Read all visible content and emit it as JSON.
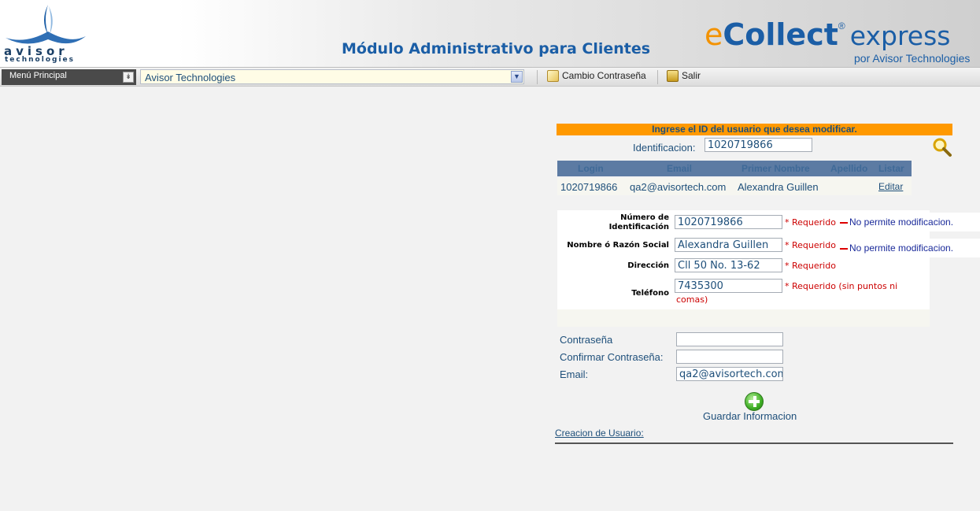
{
  "header": {
    "logo_word": "avisor",
    "logo_sub": "technologies",
    "title": "Módulo Administrativo para Clientes",
    "brand_e": "e",
    "brand_collect": "Collect",
    "brand_reg": "®",
    "brand_express": "express",
    "brand_by": "por Avisor Technologies"
  },
  "toolbar": {
    "menu_label": "Menú Principal",
    "company_selected": "Avisor Technologies",
    "change_password_label": "Cambio Contraseña",
    "exit_label": "Salir"
  },
  "search": {
    "banner": "Ingrese el ID del usuario que desea modificar.",
    "id_label": "Identificacion:",
    "id_value": "1020719866"
  },
  "table": {
    "headers": [
      "Login",
      "Email",
      "Primer Nombre",
      "Apellido",
      "Listar"
    ],
    "rows": [
      {
        "login": "1020719866",
        "email": "qa2@avisortech.com",
        "first_name": "Alexandra Guillen",
        "last_name": "",
        "action": "Editar"
      }
    ]
  },
  "form": {
    "id_label_1": "Número de",
    "id_label_2": "Identificación",
    "id_value": "1020719866",
    "id_req": "* Requerido",
    "id_note": "No permite modificacion.",
    "name_label": "Nombre ó Razón Social",
    "name_value": "Alexandra Guillen",
    "name_req": "* Requerido",
    "name_note": "No permite modificacion.",
    "address_label": "Dirección",
    "address_value": "Cll 50 No. 13-62",
    "address_req": "* Requerido",
    "phone_label": "Teléfono",
    "phone_value": "7435300",
    "phone_req_1": "* Requerido (sin puntos ni",
    "phone_req_2": "comas)"
  },
  "account": {
    "password_label": "Contraseña",
    "password_value": "",
    "confirm_label": "Confirmar Contraseña:",
    "confirm_value": "",
    "email_label": "Email:",
    "email_value": "qa2@avisortech.com"
  },
  "actions": {
    "save_label": "Guardar Informacion",
    "create_user_link": "Creacion de Usuario:"
  },
  "colors": {
    "banner": "#ff9900",
    "table_header": "#5c7ba3",
    "required": "#cc0000",
    "brand_orange": "#f39200",
    "brand_blue": "#1b5ea6"
  }
}
